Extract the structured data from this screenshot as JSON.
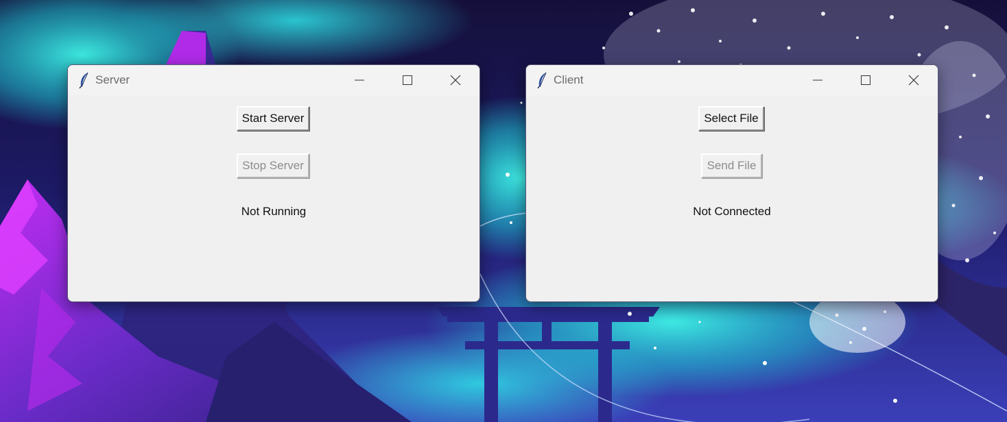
{
  "server_window": {
    "title": "Server",
    "app_icon": "feather-icon",
    "start_button": "Start Server",
    "stop_button": "Stop Server",
    "stop_button_enabled": false,
    "status": "Not Running"
  },
  "client_window": {
    "title": "Client",
    "app_icon": "feather-icon",
    "select_button": "Select File",
    "send_button": "Send File",
    "send_button_enabled": false,
    "status": "Not Connected"
  },
  "titlebar_controls": [
    "minimize-icon",
    "maximize-icon",
    "close-icon"
  ],
  "colors": {
    "window_bg": "#f0f0f0",
    "disabled_text": "#8c8c8c",
    "title_text": "#6b6b6b"
  }
}
